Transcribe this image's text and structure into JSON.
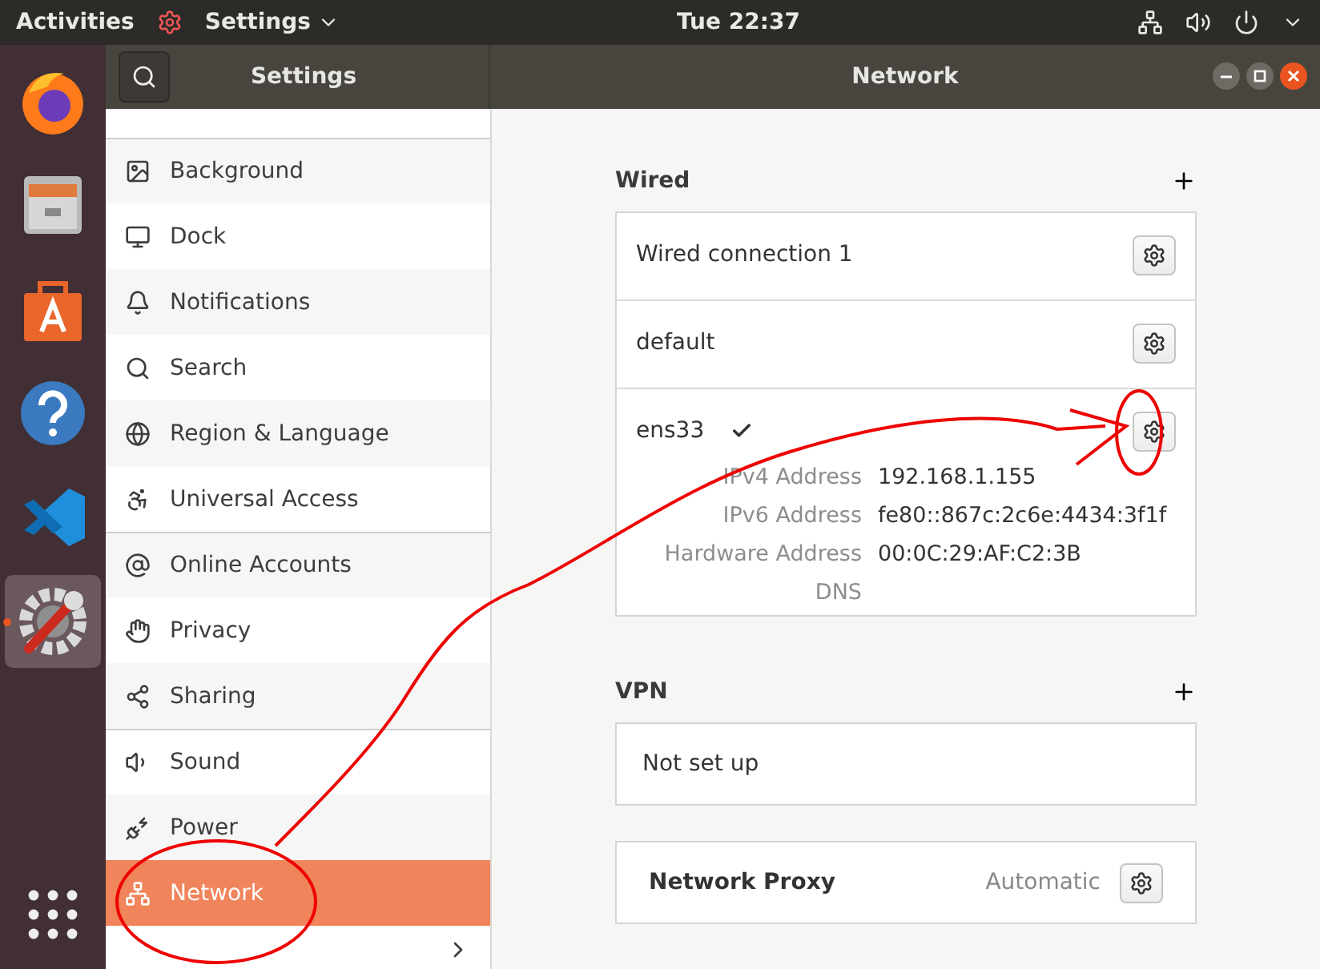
{
  "topbar": {
    "activities": "Activities",
    "app_menu": "Settings",
    "clock": "Tue 22:37"
  },
  "dock": [
    {
      "selected": false
    },
    {
      "selected": false
    },
    {
      "selected": false
    },
    {
      "selected": false
    },
    {
      "selected": false
    },
    {
      "selected": true
    }
  ],
  "headerbar": {
    "sidebar_title": "Settings",
    "title": "Network"
  },
  "sidebar": {
    "items": [
      {
        "label": "Background",
        "selected": false
      },
      {
        "label": "Dock",
        "selected": false
      },
      {
        "label": "Notifications",
        "selected": false
      },
      {
        "label": "Search",
        "selected": false
      },
      {
        "label": "Region & Language",
        "selected": false
      },
      {
        "label": "Universal Access",
        "selected": false
      },
      {
        "label": "Online Accounts",
        "selected": false
      },
      {
        "label": "Privacy",
        "selected": false
      },
      {
        "label": "Sharing",
        "selected": false
      },
      {
        "label": "Sound",
        "selected": false
      },
      {
        "label": "Power",
        "selected": false
      },
      {
        "label": "Network",
        "selected": true
      }
    ]
  },
  "wired": {
    "title": "Wired",
    "connections": [
      {
        "name": "Wired connection 1",
        "connected": false
      },
      {
        "name": "default",
        "connected": false
      },
      {
        "name": "ens33",
        "connected": true,
        "details": [
          {
            "label": "IPv4 Address",
            "value": "192.168.1.155"
          },
          {
            "label": "IPv6 Address",
            "value": "fe80::867c:2c6e:4434:3f1f"
          },
          {
            "label": "Hardware Address",
            "value": "00:0C:29:AF:C2:3B"
          },
          {
            "label": "DNS"
          }
        ]
      }
    ]
  },
  "vpn": {
    "title": "VPN",
    "status": "Not set up"
  },
  "proxy": {
    "label": "Network Proxy",
    "value": "Automatic"
  }
}
